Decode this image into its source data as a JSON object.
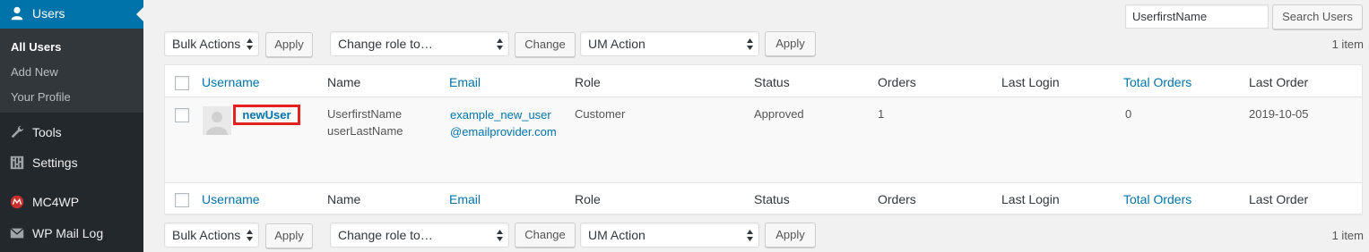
{
  "sidebar": {
    "users": {
      "label": "Users",
      "icon": "user-icon"
    },
    "submenu": [
      {
        "label": "All Users",
        "current": true
      },
      {
        "label": "Add New",
        "current": false
      },
      {
        "label": "Your Profile",
        "current": false
      }
    ],
    "items": [
      {
        "label": "Tools",
        "icon": "wrench-icon"
      },
      {
        "label": "Settings",
        "icon": "settings-icon"
      },
      {
        "label": "MC4WP",
        "icon": "mc4wp-icon"
      },
      {
        "label": "WP Mail Log",
        "icon": "mail-icon"
      }
    ]
  },
  "search": {
    "value": "UserfirstName",
    "button": "Search Users"
  },
  "toolbar_top": {
    "bulk_actions": "Bulk Actions",
    "apply1": "Apply",
    "change_role": "Change role to…",
    "change": "Change",
    "um_action": "UM Action",
    "apply2": "Apply",
    "count": "1 item"
  },
  "toolbar_bottom": {
    "bulk_actions": "Bulk Actions",
    "apply1": "Apply",
    "change_role": "Change role to…",
    "change": "Change",
    "um_action": "UM Action",
    "apply2": "Apply",
    "count": "1 item"
  },
  "columns": {
    "username": "Username",
    "name": "Name",
    "email": "Email",
    "role": "Role",
    "status": "Status",
    "orders": "Orders",
    "last_login": "Last Login",
    "total_orders": "Total Orders",
    "last_order": "Last Order"
  },
  "row": {
    "username": "newUser",
    "first_name": "UserfirstName",
    "last_name": "userLastName",
    "email": "example_new_user@emailprovider.com",
    "role": "Customer",
    "status": "Approved",
    "orders": "1",
    "last_login": "",
    "total_orders": "0",
    "last_order": "2019-10-05"
  },
  "colors": {
    "accent": "#0073aa",
    "sidebar": "#23282d",
    "highlight": "#e52020"
  }
}
